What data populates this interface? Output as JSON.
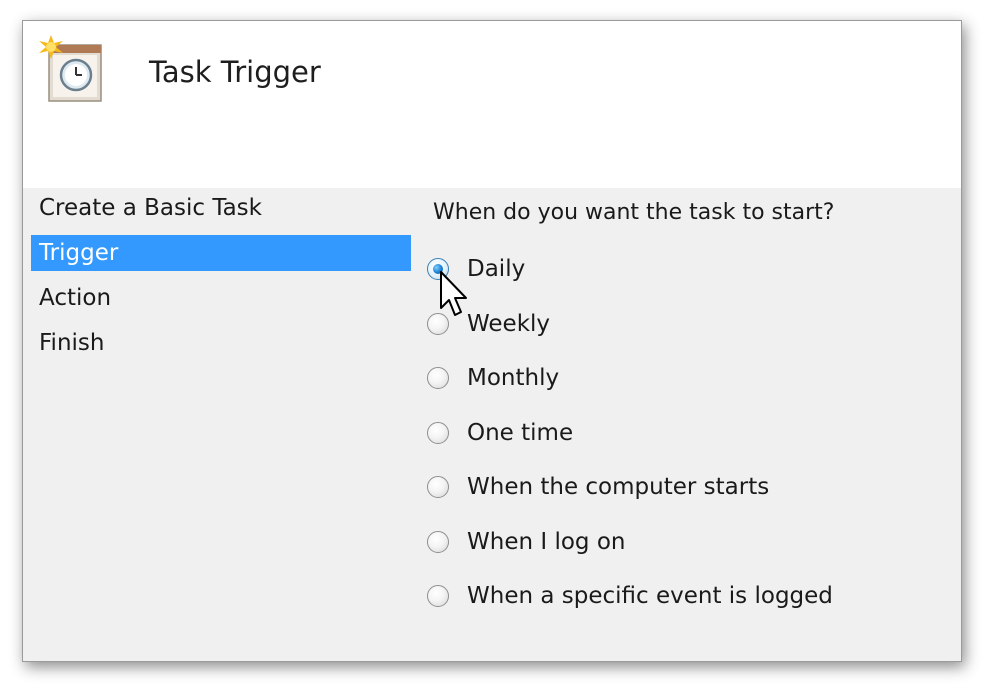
{
  "dialog": {
    "title": "Task Trigger",
    "icon": "task-scheduler-clock-icon"
  },
  "steps": [
    {
      "label": "Create a Basic Task",
      "selected": false
    },
    {
      "label": "Trigger",
      "selected": true
    },
    {
      "label": "Action",
      "selected": false
    },
    {
      "label": "Finish",
      "selected": false
    }
  ],
  "trigger": {
    "question": "When do you want the task to start?",
    "options": [
      {
        "label": "Daily",
        "checked": true
      },
      {
        "label": "Weekly",
        "checked": false
      },
      {
        "label": "Monthly",
        "checked": false
      },
      {
        "label": "One time",
        "checked": false
      },
      {
        "label": "When the computer starts",
        "checked": false
      },
      {
        "label": "When I log on",
        "checked": false
      },
      {
        "label": "When a specific event is logged",
        "checked": false
      }
    ]
  },
  "colors": {
    "selection": "#3399ff",
    "panel_background": "#f0f0f0",
    "header_background": "#ffffff"
  }
}
